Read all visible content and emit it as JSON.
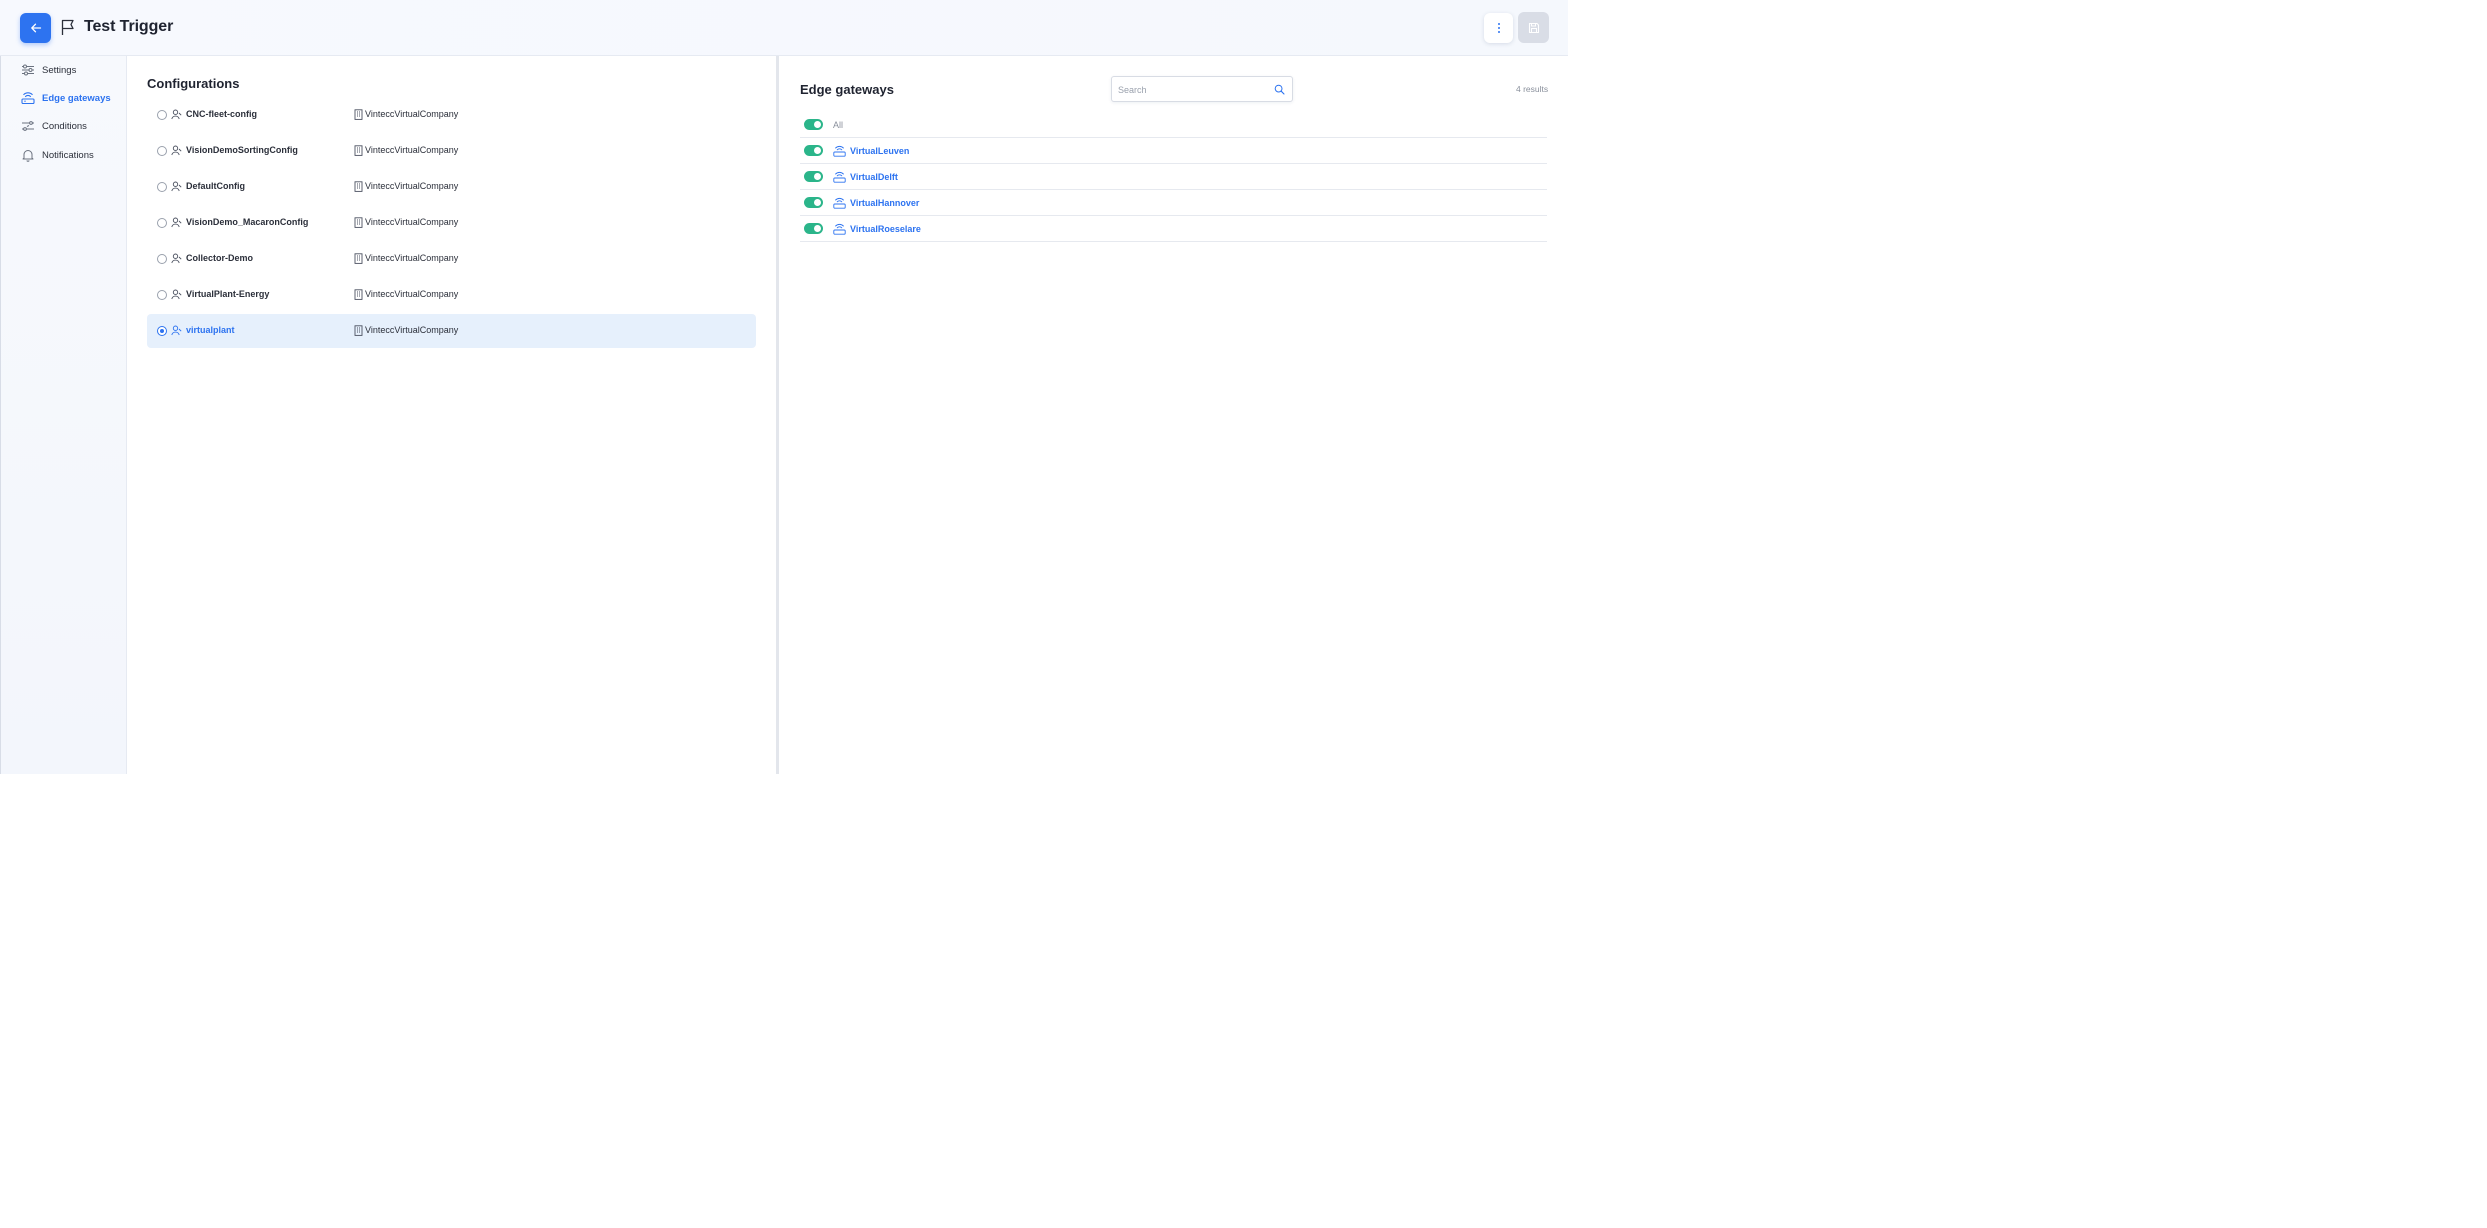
{
  "header": {
    "title": "Test Trigger"
  },
  "sidebar": {
    "items": [
      {
        "label": "Settings",
        "icon": "sliders-icon",
        "active": false
      },
      {
        "label": "Edge gateways",
        "icon": "router-icon",
        "active": true
      },
      {
        "label": "Conditions",
        "icon": "conditions-icon",
        "active": false
      },
      {
        "label": "Notifications",
        "icon": "bell-icon",
        "active": false
      }
    ]
  },
  "configurations": {
    "title": "Configurations",
    "rows": [
      {
        "name": "CNC-fleet-config",
        "company": "VinteccVirtualCompany",
        "selected": false
      },
      {
        "name": "VisionDemoSortingConfig",
        "company": "VinteccVirtualCompany",
        "selected": false
      },
      {
        "name": "DefaultConfig",
        "company": "VinteccVirtualCompany",
        "selected": false
      },
      {
        "name": "VisionDemo_MacaronConfig",
        "company": "VinteccVirtualCompany",
        "selected": false
      },
      {
        "name": "Collector-Demo",
        "company": "VinteccVirtualCompany",
        "selected": false
      },
      {
        "name": "VirtualPlant-Energy",
        "company": "VinteccVirtualCompany",
        "selected": false
      },
      {
        "name": "virtualplant",
        "company": "VinteccVirtualCompany",
        "selected": true
      }
    ]
  },
  "edge_gateways": {
    "title": "Edge gateways",
    "search_placeholder": "Search",
    "results": "4 results",
    "all_label": "All",
    "all_enabled": true,
    "rows": [
      {
        "name": "VirtualLeuven",
        "enabled": true
      },
      {
        "name": "VirtualDelft",
        "enabled": true
      },
      {
        "name": "VirtualHannover",
        "enabled": true
      },
      {
        "name": "VirtualRoeselare",
        "enabled": true
      }
    ]
  },
  "colors": {
    "accent": "#2d73f0",
    "toggle_on": "#2bb58a",
    "selected_row": "#e6f0fc"
  }
}
